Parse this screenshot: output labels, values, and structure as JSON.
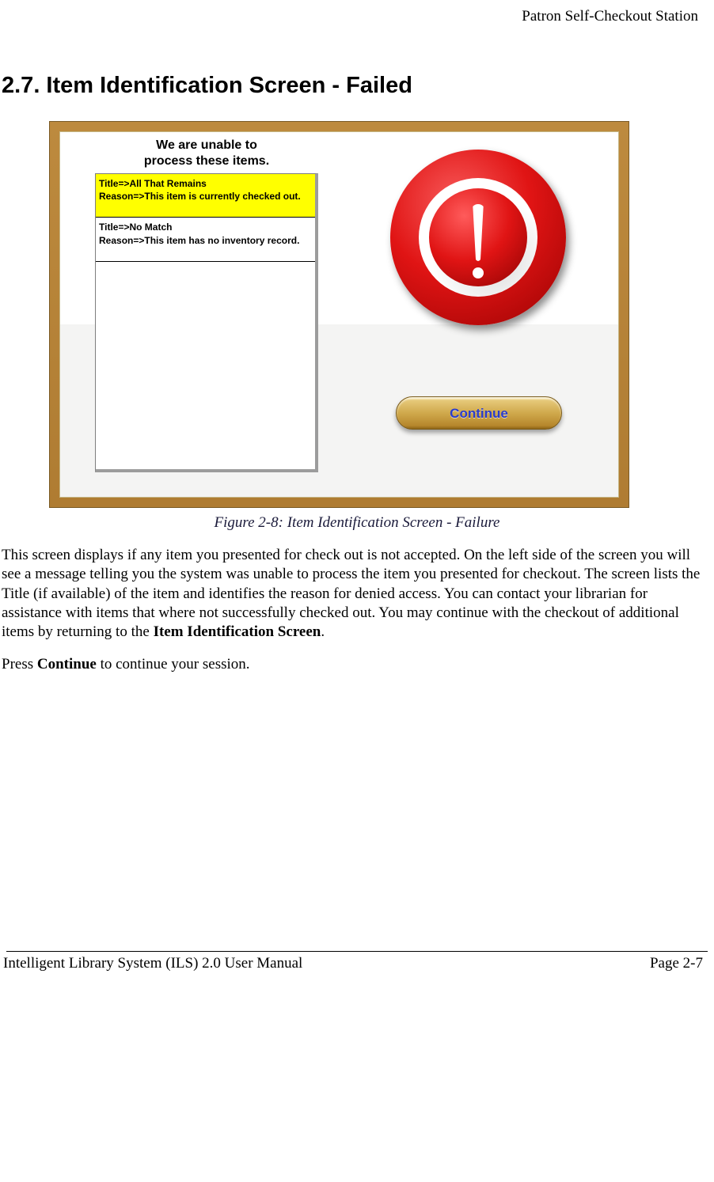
{
  "header": {
    "running_title": "Patron Self-Checkout Station"
  },
  "section": {
    "heading": "2.7.  Item Identification Screen - Failed"
  },
  "screenshot": {
    "message": "We are unable to process these items.",
    "items": [
      {
        "title_line": "Title=>All That Remains",
        "reason_line": "Reason=>This item is currently checked out.",
        "highlighted": true
      },
      {
        "title_line": "Title=>No Match",
        "reason_line": "Reason=>This item has no inventory record.",
        "highlighted": false
      }
    ],
    "continue_label": "Continue"
  },
  "caption": "Figure 2-8: Item Identification Screen - Failure",
  "body": {
    "p1_a": "This screen displays if any item you presented for check out is not accepted. On the left side of the screen you will see a message telling you the system was unable to process the item you presented for checkout. The screen lists the Title (if available) of the item and identifies the reason for denied access. You can contact your librarian for assistance with items that where not successfully checked out. You may continue with the checkout of additional items by returning to the ",
    "p1_bold": "Item Identification Screen",
    "p1_b": ".",
    "p2_a": "Press ",
    "p2_bold": "Continue",
    "p2_b": " to continue your session."
  },
  "footer": {
    "left": "Intelligent Library System (ILS) 2.0 User Manual",
    "right": "Page 2-7"
  }
}
